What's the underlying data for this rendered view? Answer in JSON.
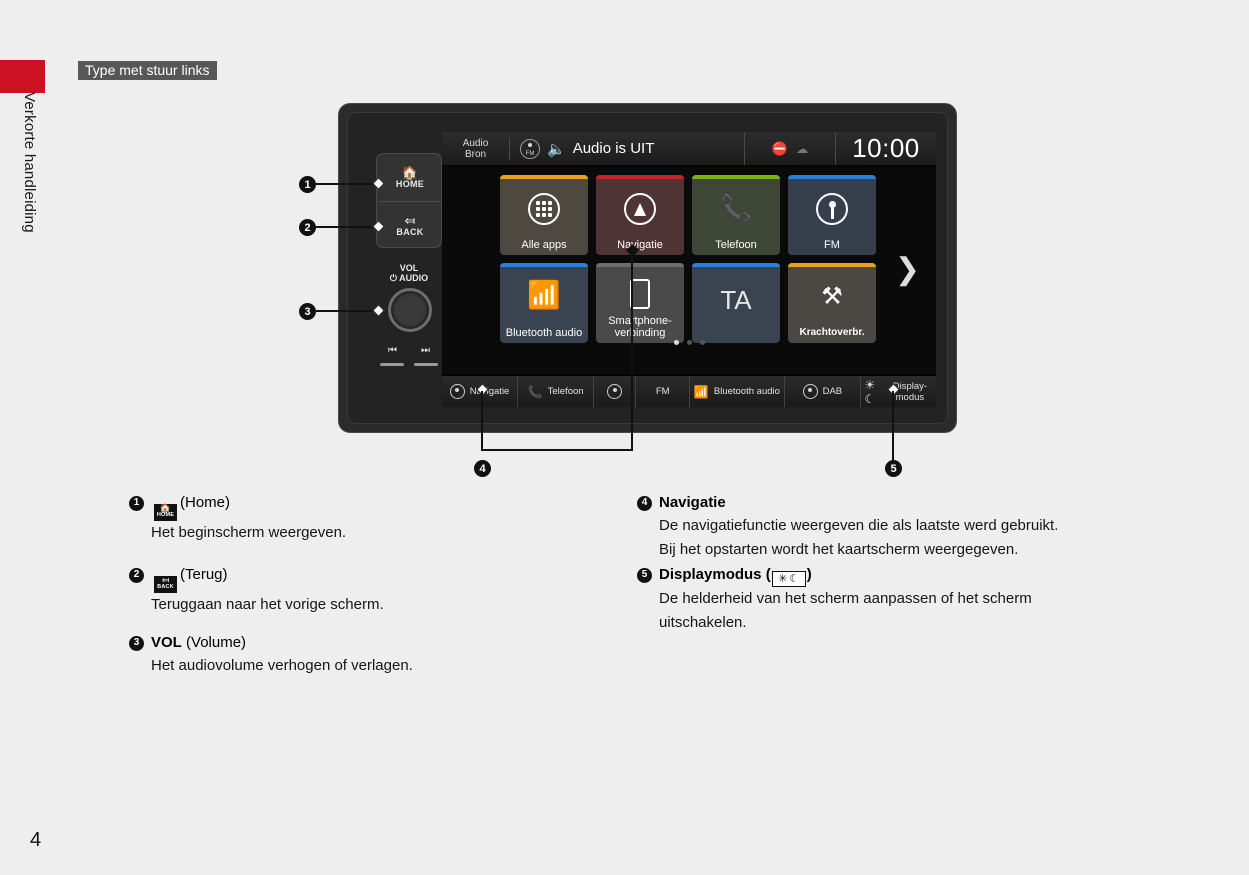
{
  "document": {
    "section_tab": "Verkorte handleiding",
    "header_title": "Type met stuur links",
    "page_number": "4"
  },
  "head_unit": {
    "hardkeys": {
      "home_icon": "home-icon",
      "home_label": "HOME",
      "back_icon": "back-arrow-icon",
      "back_label": "BACK",
      "volume_label_line1": "VOL",
      "volume_label_line2": "AUDIO",
      "power_icon": "power-icon",
      "prev_icon": "skip-previous-icon",
      "next_icon": "skip-next-icon"
    },
    "status_bar": {
      "source_line1": "Audio",
      "source_line2": "Bron",
      "band_icon": "fm-radio-icon",
      "band_icon_label": "FM",
      "speaker_icon": "speaker-mute-icon",
      "title": "Audio is UIT",
      "status_icon_1": "no-signal-icon",
      "status_icon_2": "cloud-icon",
      "clock": "10:00"
    },
    "tiles": [
      {
        "label": "Alle apps",
        "icon": "apps-grid-icon",
        "accent": "#e8a317",
        "theme": "t-orange"
      },
      {
        "label": "Navigatie",
        "icon": "navigation-arrow-icon",
        "accent": "#cc2222",
        "theme": "t-red"
      },
      {
        "label": "Telefoon",
        "icon": "phone-icon",
        "accent": "#7ab317",
        "theme": "t-green"
      },
      {
        "label": "FM",
        "icon": "radio-tower-icon",
        "accent": "#2a80d8",
        "theme": "t-blue"
      },
      {
        "label": "Bluetooth audio",
        "icon": "bluetooth-icon",
        "accent": "#2a80d8",
        "theme": "t-blue2"
      },
      {
        "label": "Smartphone-verbinding",
        "icon": "smartphone-icon",
        "accent": "#6d6d6d",
        "theme": "t-grey"
      },
      {
        "label": "TA",
        "icon": "ta-text-icon",
        "accent": "#2a80d8",
        "theme": "t-blue2"
      },
      {
        "label": "Krachtoverbr.",
        "icon": "drivetrain-icon",
        "accent": "#e8a317",
        "theme": "t-amber"
      }
    ],
    "page_indicator": {
      "total": 3,
      "active": 1
    },
    "next_page_icon": "chevron-right-icon",
    "bottom_bar": [
      {
        "label": "Navigatie",
        "icon": "navigation-arrow-icon"
      },
      {
        "label": "Telefoon",
        "icon": "phone-icon"
      },
      {
        "label": "",
        "icon": "radio-tower-icon"
      },
      {
        "label": "FM",
        "icon": ""
      },
      {
        "label": "Bluetooth audio",
        "icon": "bluetooth-icon"
      },
      {
        "label": "DAB",
        "icon": "radio-tower-icon"
      },
      {
        "label": "Display-modus",
        "icon": "brightness-moon-icon"
      }
    ]
  },
  "callouts": [
    "1",
    "2",
    "3",
    "4",
    "5"
  ],
  "legend": {
    "left": [
      {
        "num": "1",
        "glyph_top": "⌂",
        "glyph_bottom": "HOME",
        "title": "(Home)",
        "body": "Het beginscherm weergeven."
      },
      {
        "num": "2",
        "glyph_top": "↶",
        "glyph_bottom": "BACK",
        "title": "(Terug)",
        "body": "Teruggaan naar het vorige scherm."
      },
      {
        "num": "3",
        "bold": "VOL",
        "title": "(Volume)",
        "body": "Het audiovolume verhogen of verlagen."
      }
    ],
    "right": [
      {
        "num": "4",
        "bold": "Navigatie",
        "body_line1": "De navigatiefunctie weergeven die als laatste werd gebruikt.",
        "body_line2": "Bij het opstarten wordt het kaartscherm weergegeven."
      },
      {
        "num": "5",
        "bold": "Displaymodus",
        "glyph_sun": "✳",
        "glyph_moon": "☾",
        "body_line1": "De helderheid van het scherm aanpassen of het scherm",
        "body_line2": "uitschakelen."
      }
    ]
  }
}
